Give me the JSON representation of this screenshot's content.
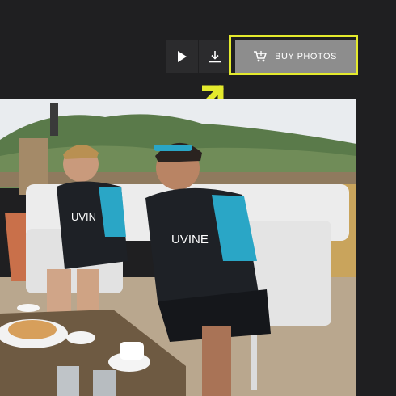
{
  "toolbar": {
    "play": {
      "icon": "play-icon"
    },
    "download": {
      "icon": "download-icon"
    },
    "buy": {
      "label": "BUY PHOTOS",
      "icon": "cart-icon"
    }
  },
  "highlight": {
    "color": "#e4ea2d"
  },
  "photo": {
    "jersey_text_left": "UVIN",
    "jersey_text_right": "UVINE"
  }
}
